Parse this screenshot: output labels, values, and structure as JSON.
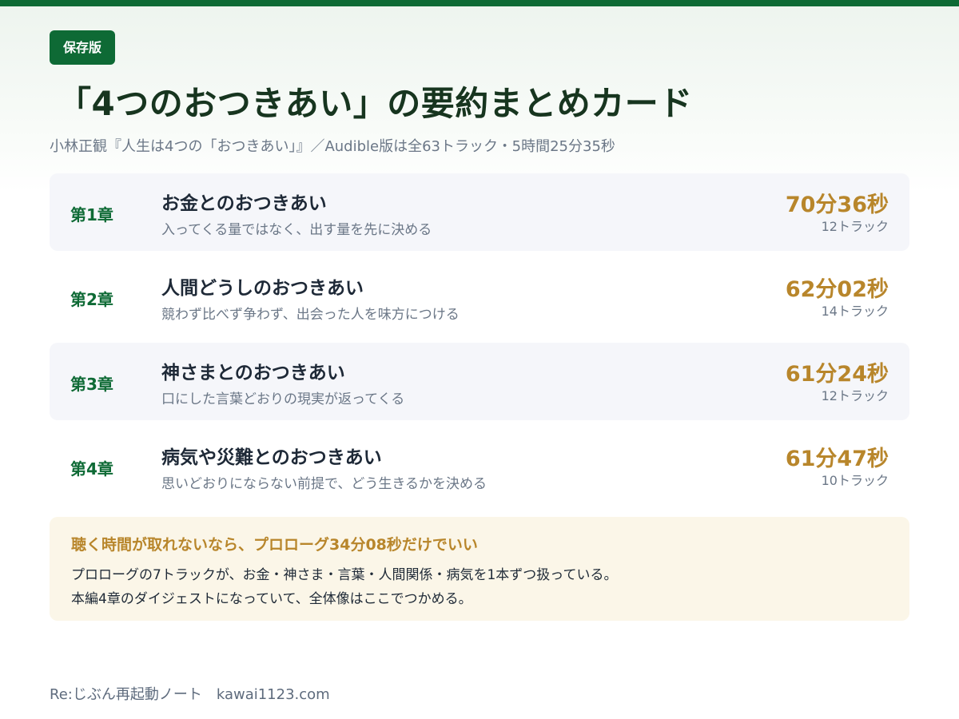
{
  "colors": {
    "brand_green": "#0e6a35",
    "accent_gold": "#b8862b",
    "row_shade": "#f5f6fa",
    "tip_background": "#fbf6e8"
  },
  "header": {
    "badge": "保存版",
    "title": "「4つのおつきあい」の要約まとめカード",
    "subtitle": "小林正観『人生は4つの「おつきあい」』／Audible版は全63トラック・5時間25分35秒"
  },
  "chapters": [
    {
      "label": "第1章",
      "title": "お金とのおつきあい",
      "desc": "入ってくる量ではなく、出す量を先に決める",
      "duration": "70分36秒",
      "tracks": "12トラック"
    },
    {
      "label": "第2章",
      "title": "人間どうしのおつきあい",
      "desc": "競わず比べず争わず、出会った人を味方につける",
      "duration": "62分02秒",
      "tracks": "14トラック"
    },
    {
      "label": "第3章",
      "title": "神さまとのおつきあい",
      "desc": "口にした言葉どおりの現実が返ってくる",
      "duration": "61分24秒",
      "tracks": "12トラック"
    },
    {
      "label": "第4章",
      "title": "病気や災難とのおつきあい",
      "desc": "思いどおりにならない前提で、どう生きるかを決める",
      "duration": "61分47秒",
      "tracks": "10トラック"
    }
  ],
  "tip": {
    "title": "聴く時間が取れないなら、プロローグ34分08秒だけでいい",
    "line1": "プロローグの7トラックが、お金・神さま・言葉・人間関係・病気を1本ずつ扱っている。",
    "line2": "本編4章のダイジェストになっていて、全体像はここでつかめる。"
  },
  "footer": {
    "blog": "Re:じぶん再起動ノート",
    "site": "kawai1123.com"
  }
}
